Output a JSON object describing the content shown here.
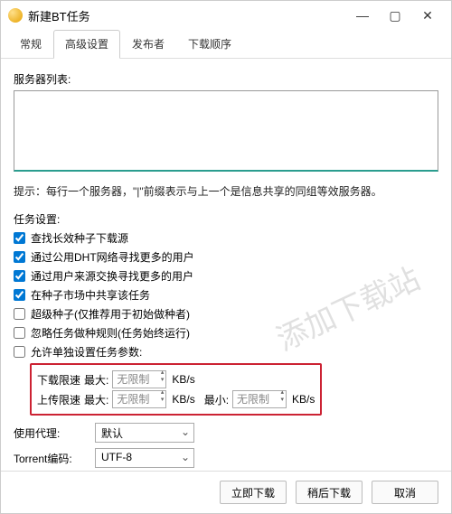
{
  "window": {
    "title": "新建BT任务"
  },
  "tabs": [
    "常规",
    "高级设置",
    "发布者",
    "下载顺序"
  ],
  "active_tab": 1,
  "server_list": {
    "label": "服务器列表:",
    "value": ""
  },
  "hint": "提示：每行一个服务器，\"|\"前缀表示与上一个是信息共享的同组等效服务器。",
  "task_label": "任务设置:",
  "checks": [
    {
      "label": "查找长效种子下载源",
      "checked": true
    },
    {
      "label": "通过公用DHT网络寻找更多的用户",
      "checked": true
    },
    {
      "label": "通过用户来源交换寻找更多的用户",
      "checked": true
    },
    {
      "label": "在种子市场中共享该任务",
      "checked": true
    },
    {
      "label": "超级种子(仅推荐用于初始做种者)",
      "checked": false
    },
    {
      "label": "忽略任务做种规则(任务始终运行)",
      "checked": false
    },
    {
      "label": "允许单独设置任务参数:",
      "checked": false
    }
  ],
  "limits": {
    "dl_label": "下载限速",
    "ul_label": "上传限速",
    "max": "最大:",
    "min": "最小:",
    "placeholder": "无限制",
    "unit": "KB/s"
  },
  "proxy": {
    "label": "使用代理:",
    "value": "默认"
  },
  "encoding": {
    "label": "Torrent编码:",
    "value": "UTF-8"
  },
  "buttons": {
    "now": "立即下载",
    "later": "稍后下载",
    "cancel": "取消"
  },
  "watermark": "添加下载站"
}
